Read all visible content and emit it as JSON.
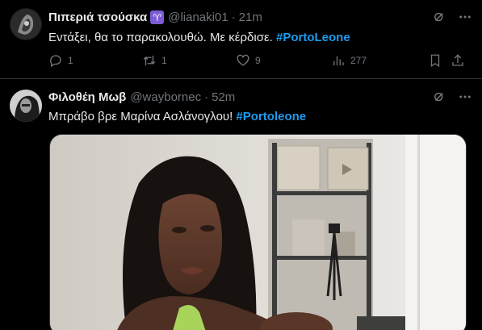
{
  "tweets": [
    {
      "display_name": "Πιπεριά τσούσκα",
      "badge": "♈",
      "handle": "@lianaki01",
      "separator": "·",
      "time": "21m",
      "text": "Εντάξει, θα το παρακολουθώ. Με κέρδισε. ",
      "hashtag": "#PortoLeone",
      "replies": "1",
      "retweets": "1",
      "likes": "9",
      "views": "277"
    },
    {
      "display_name": "Φιλοθέη Μωβ",
      "handle": "@waybornec",
      "separator": "·",
      "time": "52m",
      "text": "Μπράβο βρε Μαρίνα Ασλάνογλου! ",
      "hashtag": "#Portoleone"
    }
  ],
  "colors": {
    "accent": "#1d9bf0",
    "muted": "#71767b",
    "text": "#e7e9ea",
    "background": "#000000"
  },
  "icons": [
    "grok-icon",
    "more-icon",
    "reply-icon",
    "retweet-icon",
    "like-icon",
    "views-icon",
    "bookmark-icon",
    "share-icon"
  ]
}
